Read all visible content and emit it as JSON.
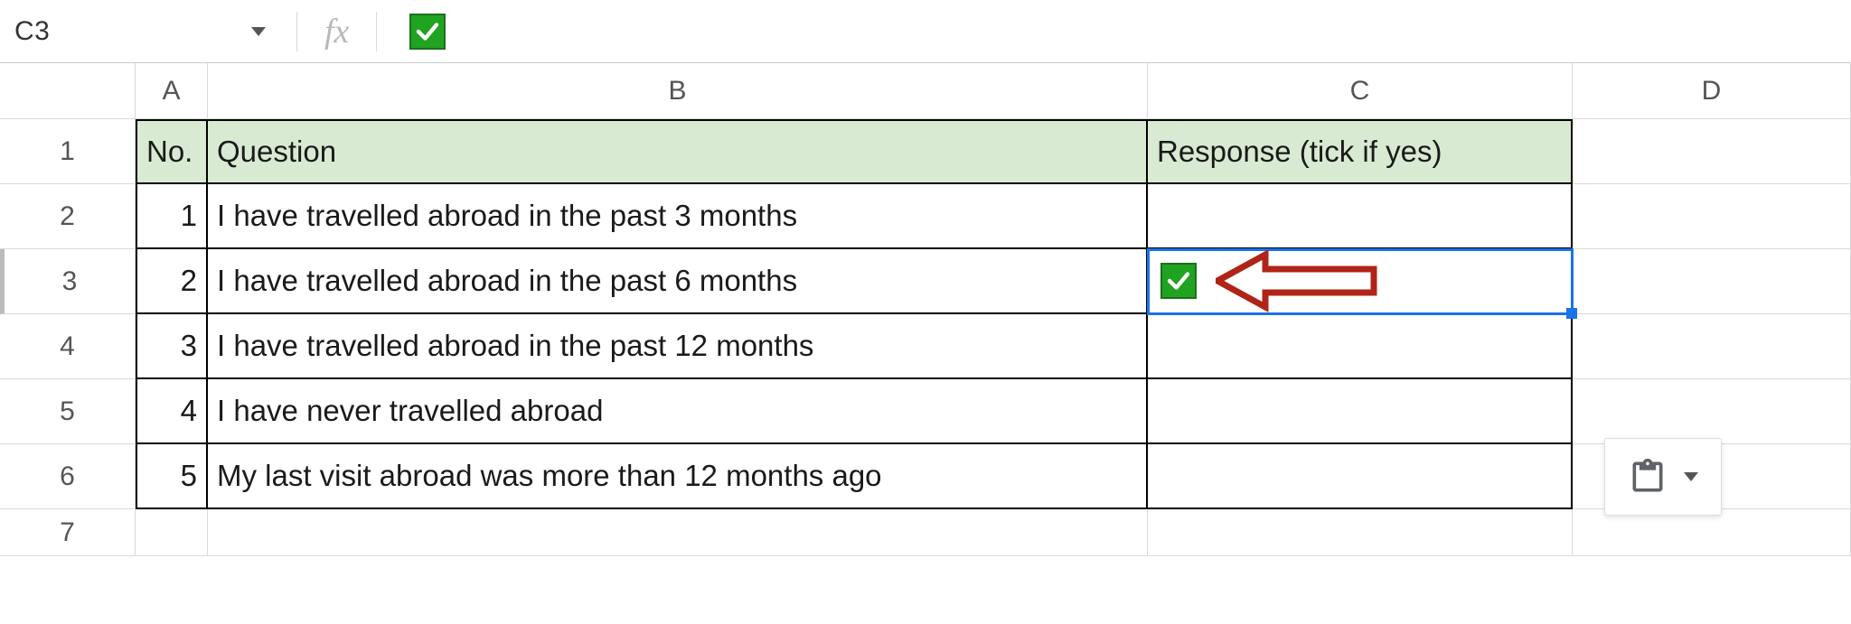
{
  "formula_bar": {
    "active_cell": "C3",
    "content_icon": "checkmark"
  },
  "columns": [
    "A",
    "B",
    "C",
    "D"
  ],
  "row_numbers": [
    "1",
    "2",
    "3",
    "4",
    "5",
    "6",
    "7"
  ],
  "table": {
    "headers": {
      "no": "No.",
      "question": "Question",
      "response": "Response (tick if yes)"
    },
    "rows": [
      {
        "no": "1",
        "question": "I have travelled abroad in the past 3 months",
        "response": ""
      },
      {
        "no": "2",
        "question": "I have travelled abroad in the past 6 months",
        "response": "✔"
      },
      {
        "no": "3",
        "question": "I have travelled abroad in the past 12 months",
        "response": ""
      },
      {
        "no": "4",
        "question": "I have never travelled abroad",
        "response": ""
      },
      {
        "no": "5",
        "question": "My last visit abroad was more than 12 months ago",
        "response": ""
      }
    ]
  },
  "annotation": {
    "arrow_points_to": "C3"
  }
}
